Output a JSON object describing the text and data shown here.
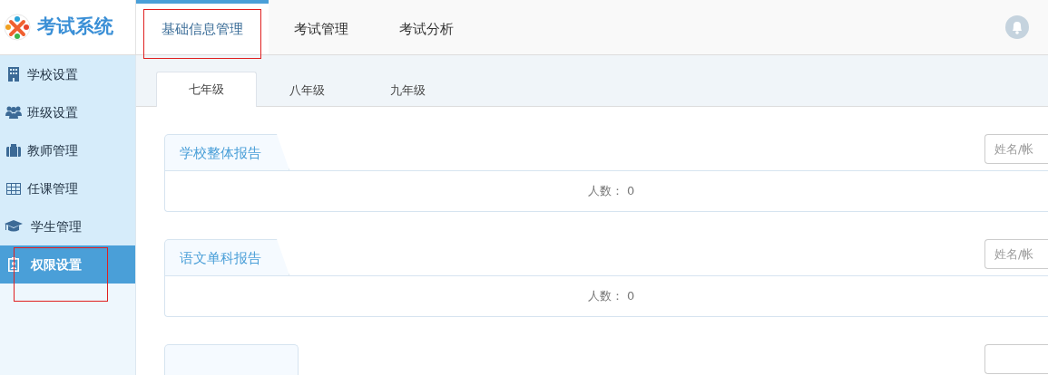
{
  "logo": {
    "title": "考试系统"
  },
  "top_tabs": [
    {
      "label": "基础信息管理",
      "selected": true,
      "annotated": true
    },
    {
      "label": "考试管理",
      "selected": false,
      "annotated": false
    },
    {
      "label": "考试分析",
      "selected": false,
      "annotated": false
    }
  ],
  "sidebar": {
    "items": [
      {
        "label": "学校设置",
        "kind": "building",
        "selected": false,
        "annotated": false
      },
      {
        "label": "班级设置",
        "kind": "users",
        "selected": false,
        "annotated": false
      },
      {
        "label": "教师管理",
        "kind": "briefcase",
        "selected": false,
        "annotated": false
      },
      {
        "label": "任课管理",
        "kind": "table",
        "selected": false,
        "annotated": false
      },
      {
        "label": "学生管理",
        "kind": "cap",
        "selected": false,
        "annotated": false
      },
      {
        "label": "权限设置",
        "kind": "badge",
        "selected": true,
        "annotated": true
      }
    ]
  },
  "grade_tabs": [
    {
      "label": "七年级",
      "selected": true
    },
    {
      "label": "八年级",
      "selected": false
    },
    {
      "label": "九年级",
      "selected": false
    }
  ],
  "reports": [
    {
      "title": "学校整体报告",
      "placeholder": "姓名/帐",
      "count_label": "人数：",
      "count": "0"
    },
    {
      "title": "语文单科报告",
      "placeholder": "姓名/帐",
      "count_label": "人数：",
      "count": "0"
    }
  ]
}
